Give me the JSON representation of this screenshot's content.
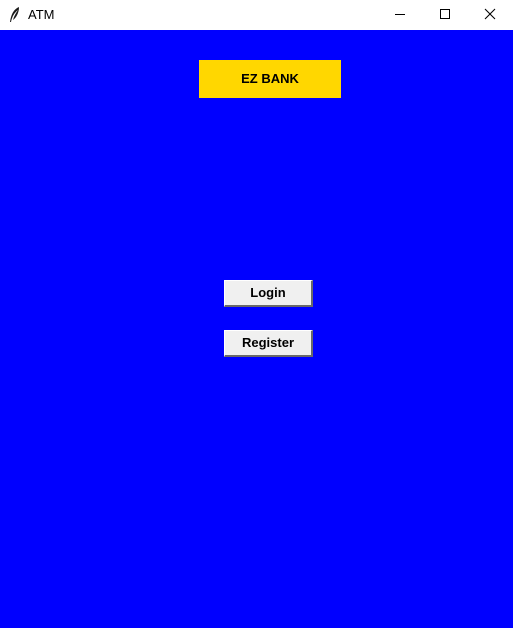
{
  "window": {
    "title": "ATM",
    "icon": "feather-icon",
    "controls": [
      "minimize-icon",
      "maximize-icon",
      "close-icon"
    ]
  },
  "main": {
    "bank_label": "EZ BANK",
    "login_label": "Login",
    "register_label": "Register"
  },
  "colors": {
    "background": "#0000ff",
    "label_background": "#ffd700",
    "button_background": "#f0f0f0"
  }
}
